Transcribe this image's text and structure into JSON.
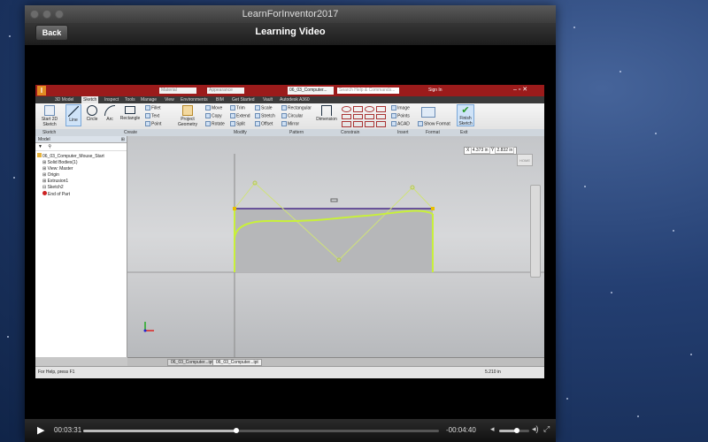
{
  "window": {
    "title": "LearnForInventor2017"
  },
  "nav": {
    "back_label": "Back",
    "title": "Learning Video"
  },
  "inventor": {
    "doc_tab": "06_03_Computer...",
    "search_placeholder": "Search Help & Commands...",
    "sign_in": "Sign In",
    "style_field": "Material",
    "appearance_field": "Appearance",
    "tabs": [
      "3D Model",
      "Sketch",
      "Inspect",
      "Tools",
      "Manage",
      "View",
      "Environments",
      "BIM",
      "Get Started",
      "Vault",
      "Autodesk A360"
    ],
    "ribbon": {
      "start_sketch": "Start 2D Sketch",
      "line": "Line",
      "circle": "Circle",
      "arc": "Arc",
      "rectangle": "Rectangle",
      "fillet": "Fillet",
      "text": "Text",
      "point": "Point",
      "project_geometry": "Project Geometry",
      "move": "Move",
      "copy": "Copy",
      "rotate": "Rotate",
      "trim": "Trim",
      "extend": "Extend",
      "split": "Split",
      "scale": "Scale",
      "stretch": "Stretch",
      "offset": "Offset",
      "rect_pattern": "Rectangular",
      "circular": "Circular",
      "mirror": "Mirror",
      "dimension": "Dimension",
      "image": "Image",
      "points": "Points",
      "acad": "ACAD",
      "show_format": "Show Format",
      "finish_sketch": "Finish Sketch"
    },
    "panels": [
      "Sketch",
      "Create",
      "Modify",
      "Pattern",
      "Constrain",
      "Insert",
      "Format",
      "Exit"
    ],
    "browser": {
      "header": "Model",
      "items": [
        "06_03_Computer_Mouse_Start",
        "Solid Bodies(1)",
        "View: Master",
        "Origin",
        "Extrusion1",
        "Sketch2",
        "End of Part"
      ]
    },
    "coords": {
      "x": "4.373 in",
      "y": "2.832 in"
    },
    "viewcube": "HOME",
    "doc_tabs": [
      "06_03_Computer...ipt",
      "06_03_Computer...ipt"
    ],
    "status_help": "For Help, press F1",
    "status_coords": "5.210 in"
  },
  "player": {
    "elapsed": "00:03:31",
    "remaining": "-00:04:40",
    "progress": 0.43,
    "volume": 0.6
  }
}
